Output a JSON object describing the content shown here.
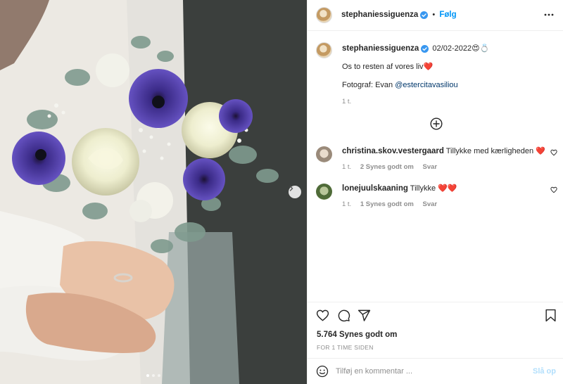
{
  "header": {
    "username": "stephaniessiguenza",
    "separator": "•",
    "follow_label": "Følg",
    "more_icon": "more-horizontal-icon"
  },
  "caption": {
    "username": "stephaniessiguenza",
    "date_text": "02/02-2022😍💍",
    "line1": "Os to resten af vores liv❤️",
    "photo_prefix": "Fotograf: Evan ",
    "photo_mention": "@estercitavasiliou",
    "time": "1 t."
  },
  "load_more_icon": "plus-circle-icon",
  "comments": [
    {
      "username": "christina.skov.vestergaard",
      "text": "Tillykke med kærligheden ❤️",
      "time": "1 t.",
      "likes": "2 Synes godt om",
      "reply": "Svar"
    },
    {
      "username": "lonejuulskaaning",
      "text": "Tillykke ❤️❤️",
      "time": "1 t.",
      "likes": "1 Synes godt om",
      "reply": "Svar"
    }
  ],
  "actions": {
    "likes": "5.764 Synes godt om",
    "time_ago": "FOR 1 TIME SIDEN"
  },
  "comment_bar": {
    "placeholder": "Tilføj en kommentar ...",
    "post_label": "Slå op"
  },
  "carousel": {
    "slide_count": 3,
    "active_index": 0
  },
  "colors": {
    "link_blue": "#0095f6",
    "mention": "#00376b",
    "muted": "#8e8e8e",
    "verified": "#3897f0",
    "heart": "#ed4956"
  }
}
